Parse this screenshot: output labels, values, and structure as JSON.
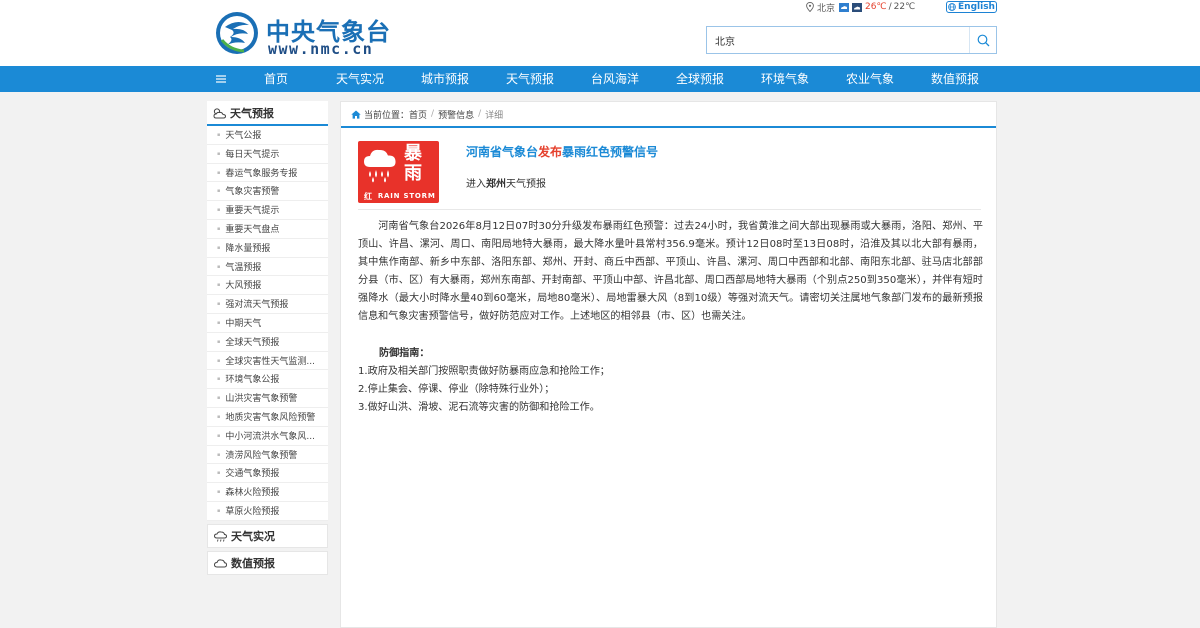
{
  "header": {
    "logo_cn": "中央气象台",
    "logo_en": "www.nmc.cn",
    "weather": {
      "city": "北京",
      "temp_high": "26℃",
      "sep": "/",
      "temp_low": "22℃"
    },
    "english_label": "English",
    "search": {
      "value": "北京",
      "placeholder": ""
    }
  },
  "nav": {
    "items": [
      {
        "label": "首页"
      },
      {
        "label": "天气实况"
      },
      {
        "label": "城市预报"
      },
      {
        "label": "天气预报"
      },
      {
        "label": "台风海洋"
      },
      {
        "label": "全球预报"
      },
      {
        "label": "环境气象"
      },
      {
        "label": "农业气象"
      },
      {
        "label": "数值预报"
      }
    ]
  },
  "sidebar": {
    "section_forecast": "天气预报",
    "items": [
      {
        "label": "天气公报"
      },
      {
        "label": "每日天气提示"
      },
      {
        "label": "春运气象服务专报"
      },
      {
        "label": "气象灾害预警"
      },
      {
        "label": "重要天气提示"
      },
      {
        "label": "重要天气盘点"
      },
      {
        "label": "降水量预报"
      },
      {
        "label": "气温预报"
      },
      {
        "label": "大风预报"
      },
      {
        "label": "强对流天气预报"
      },
      {
        "label": "中期天气"
      },
      {
        "label": "全球天气预报"
      },
      {
        "label": "全球灾害性天气监测..."
      },
      {
        "label": "环境气象公报"
      },
      {
        "label": "山洪灾害气象预警"
      },
      {
        "label": "地质灾害气象风险预警"
      },
      {
        "label": "中小河流洪水气象风..."
      },
      {
        "label": "渍涝风险气象预警"
      },
      {
        "label": "交通气象预报"
      },
      {
        "label": "森林火险预报"
      },
      {
        "label": "草原火险预报"
      }
    ],
    "section_observation": "天气实况",
    "section_numerical": "数值预报"
  },
  "breadcrumb": {
    "prefix": "当前位置：",
    "home": "首页",
    "sep": "/",
    "level2": "预警信息",
    "current": "详细"
  },
  "alert": {
    "badge": {
      "char1": "暴",
      "char2": "雨",
      "level": "红",
      "english": "RAIN STORM"
    },
    "title_part1": "河南省气象台",
    "title_highlight": "发布",
    "title_part2": "暴雨红色预警信号",
    "enter_prefix": "进入",
    "enter_city": "郑州",
    "enter_suffix": "天气预报",
    "body": "河南省气象台2026年8月12日07时30分升级发布暴雨红色预警：过去24小时，我省黄淮之间大部出现暴雨或大暴雨，洛阳、郑州、平顶山、许昌、漯河、周口、南阳局地特大暴雨，最大降水量叶县常村356.9毫米。预计12日08时至13日08时，沿淮及其以北大部有暴雨，其中焦作南部、新乡中东部、洛阳东部、郑州、开封、商丘中西部、平顶山、许昌、漯河、周口中西部和北部、南阳东北部、驻马店北部部分县（市、区）有大暴雨，郑州东南部、开封南部、平顶山中部、许昌北部、周口西部局地特大暴雨（个别点250到350毫米），并伴有短时强降水（最大小时降水量40到60毫米，局地80毫米）、局地雷暴大风（8到10级）等强对流天气。请密切关注属地气象部门发布的最新预报信息和气象灾害预警信号，做好防范应对工作。上述地区的相邻县（市、区）也需关注。",
    "guide_title": "防御指南：",
    "guide_items": [
      {
        "text": "1.政府及相关部门按照职责做好防暴雨应急和抢险工作；"
      },
      {
        "text": "2.停止集会、停课、停业（除特殊行业外）；"
      },
      {
        "text": "3.做好山洪、滑坡、泥石流等灾害的防御和抢险工作。"
      }
    ]
  },
  "colors": {
    "nav_bg": "#1b8ad6",
    "title_blue": "#1b8ad6",
    "alert_red": "#e8322a",
    "highlight_red": "#e5412d"
  }
}
